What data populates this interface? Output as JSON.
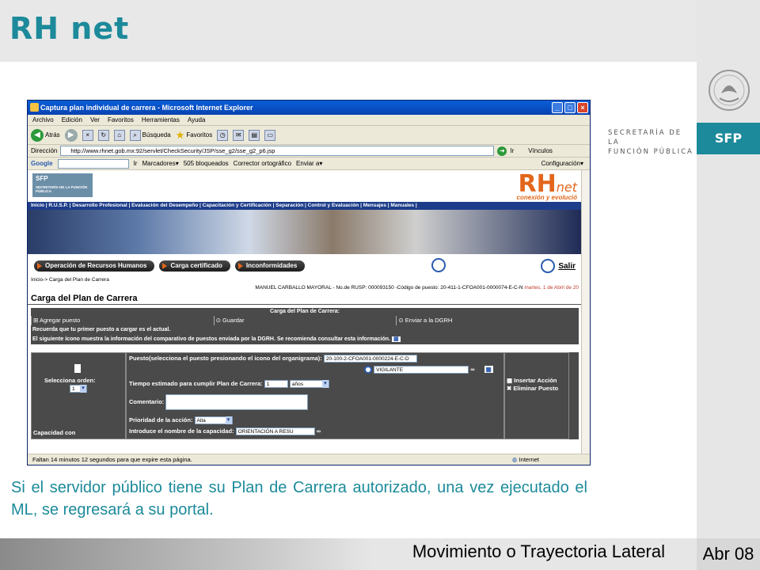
{
  "slide": {
    "title": "RH net",
    "caption": "Si el servidor público tiene su Plan de Carrera autorizado, una vez ejecutado el ML, se regresará a su portal.",
    "footer_text": "Movimiento o Trayectoria Lateral",
    "footer_date": "Abr 08",
    "brand_tab": "SFP",
    "secretaria_line1": "SECRETARÍA DE LA",
    "secretaria_line2": "FUNCIÓN PÚBLICA",
    "accent_color": "#1c8a9a"
  },
  "browser": {
    "window_title": "Captura plan individual de carrera - Microsoft Internet Explorer",
    "menu": [
      "Archivo",
      "Edición",
      "Ver",
      "Favoritos",
      "Herramientas",
      "Ayuda"
    ],
    "toolbar": {
      "back": "Atrás",
      "search": "Búsqueda",
      "favorites": "Favoritos"
    },
    "address_label": "Dirección",
    "address_url": "http://www.rhnet.gob.mx:92/servlet/CheckSecurity/JSP/sse_g2/sse_g2_p6.jsp",
    "go_label": "Ir",
    "links_label": "Vínculos",
    "googlebar": {
      "label": "Google",
      "go": "Ir",
      "bookmarks": "Marcadores▾",
      "blocked": "505 bloqueados",
      "spell": "Corrector ortográfico",
      "send": "Enviar a▾",
      "settings": "Configuración▾"
    },
    "status_left": "Faltan  14 minutos 12 segundos para que expire esta página.",
    "status_right": "Internet"
  },
  "rhnet": {
    "sfp_label": "SFP",
    "sfp_sub": "SECRETARÍA DE LA FUNCIÓN PÚBLICA",
    "logo_rh": "RH",
    "logo_net": "net",
    "slogan": "conexión y evolució",
    "nav": "Inicio | R.U.S.P. | Desarrollo Profesional | Evaluación del Desempeño | Capacitación y Certificación | Separación | Control y Evaluación | Mensajes | Manuales |",
    "btn_operacion": "Operación de Recursos Humanos",
    "btn_carga": "Carga certificado",
    "btn_inconformidades": "Inconformidades",
    "salir": "Salir",
    "breadcrumb": "Inicio-> Carga del Plan de Carrera",
    "user_line": "MANUEL CARBALLO MAYORAL - No.de RUSP: 000093150 -Código de puesto:  20-411-1-CFOA001-0000074-E-C-N",
    "date_line": "martes, 1 de Abril de 20",
    "page_title": "Carga del Plan de Carrera",
    "grid_title": "Carga del Plan de Carrera:",
    "action_add": "Agregar puesto",
    "action_save": "Guardar",
    "action_send": "Enviar a la DGRH",
    "note1": "Recuerda que tu primer puesto a cargar es el actual.",
    "note2": "El siguiente ícono muestra la información del comparativo de puestos enviada por la DGRH. Se recomienda consultar esta información.",
    "orden_label": "Selecciona orden:",
    "orden_value": "1",
    "puesto_label": "Puesto(selecciona el puesto presionando el icono del organigrama):",
    "puesto_code": "20-100-2-CFOA001-0000224-E-C-D",
    "puesto_name": "VIGILANTE",
    "tiempo_label": "Tiempo estimado para cumplir Plan de Carrera:",
    "tiempo_value": "1",
    "tiempo_unit": "años",
    "comentario_label": "Comentario:",
    "insertar": "Insertar Acción",
    "eliminar": "Eliminar Puesto",
    "capacidad_label": "Capacidad con",
    "prioridad_label": "Prioridad de la acción:",
    "prioridad_value": "Alta",
    "capacidad_nombre_label": "Introduce el nombre de la capacidad:",
    "capacidad_nombre_value": "ORIENTACIÓN A RESU"
  }
}
